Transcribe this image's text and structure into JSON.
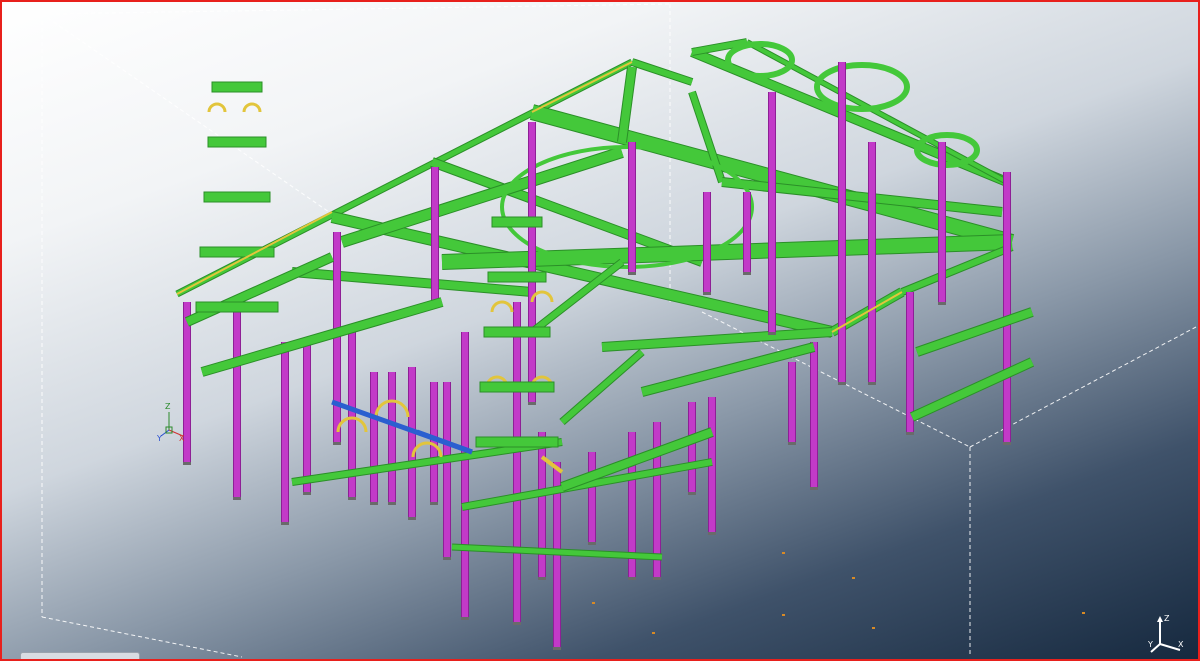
{
  "app": {
    "view_name": "3D model view",
    "frame_color": "#e8201c"
  },
  "colors": {
    "beam_green": "#44c83a",
    "beam_green_dark": "#2b8f28",
    "column_magenta": "#c23ac8",
    "column_magenta_dark": "#8e1f96",
    "brace_yellow": "#e2c53c",
    "beam_blue": "#2a5fd0",
    "plate_orange": "#d98a25",
    "work_area_line": "#ffffff"
  },
  "icons": {
    "local_axis": "xyz-axis-icon",
    "view_axis": "view-orientation-icon"
  },
  "axis_labels": {
    "local_x": "X",
    "local_y": "Y",
    "local_z": "Z",
    "view_z": "Z",
    "view_x": "X",
    "view_y": "Y"
  }
}
